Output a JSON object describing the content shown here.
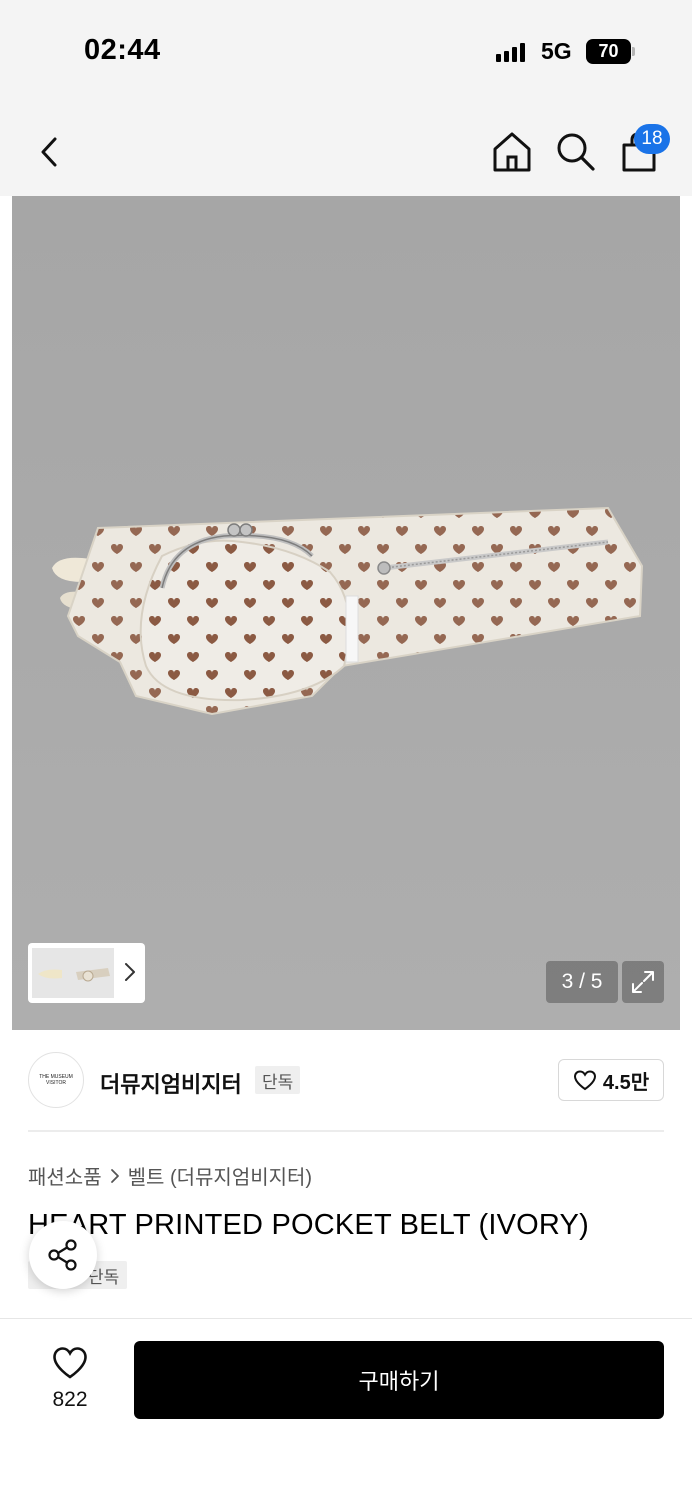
{
  "status_bar": {
    "time": "02:44",
    "network": "5G",
    "battery": "70"
  },
  "nav": {
    "icons": [
      "chevron-left-icon",
      "home-icon",
      "search-icon",
      "shopping-bag-icon"
    ],
    "cart_count": "18"
  },
  "gallery": {
    "page_indicator": "3 / 5",
    "current_page": 3,
    "total_pages": 5,
    "background": "#a9a9a9"
  },
  "brand": {
    "logo_text": "THE MUSEUM VISITOR",
    "name": "더뮤지엄비지터",
    "tag": "단독",
    "like_count": "4.5만"
  },
  "breadcrumb": {
    "category": "패션소품",
    "subcategory": "벨트 (더뮤지엄비지터)"
  },
  "product": {
    "title": "HEART PRINTED POCKET BELT (IVORY)",
    "tag": "단독"
  },
  "bottom_bar": {
    "wish_count": "822",
    "buy_label": "구매하기"
  },
  "colors": {
    "accent_badge": "#1a73e8",
    "buy_button": "#000000",
    "heart_print": "#8b5a43"
  }
}
